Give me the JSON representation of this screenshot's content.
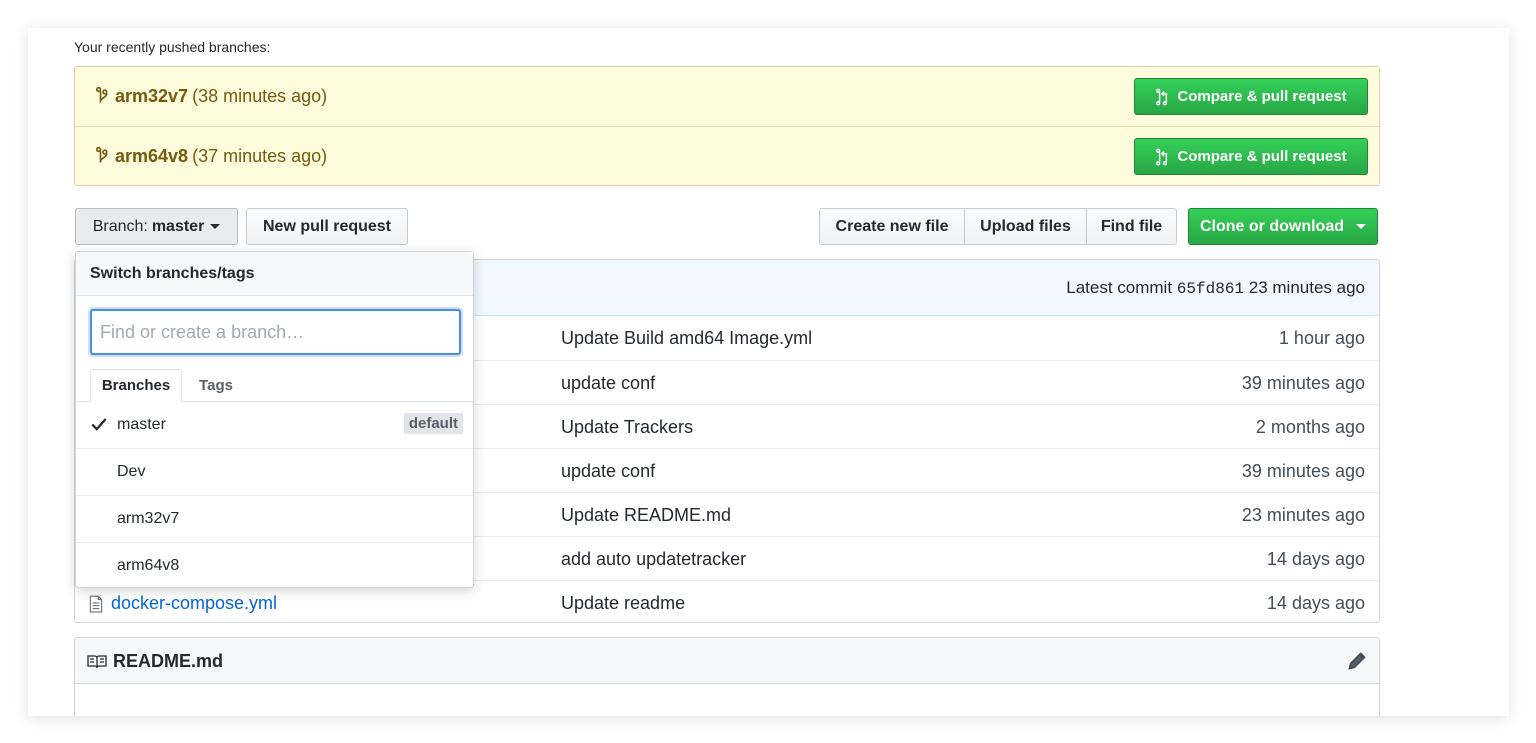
{
  "recent": {
    "label": "Your recently pushed branches:",
    "branches": [
      {
        "name": "arm32v7",
        "age": "(38 minutes ago)",
        "button": "Compare & pull request"
      },
      {
        "name": "arm64v8",
        "age": "(37 minutes ago)",
        "button": "Compare & pull request"
      }
    ]
  },
  "toolbar": {
    "branch_prefix": "Branch:",
    "branch_name": "master",
    "new_pr": "New pull request",
    "create_file": "Create new file",
    "upload_files": "Upload files",
    "find_file": "Find file",
    "clone": "Clone or download"
  },
  "commit": {
    "prefix": "Latest commit",
    "sha": "65fd861",
    "age": "23 minutes ago"
  },
  "files": [
    {
      "name": "",
      "message": "Update Build amd64 Image.yml",
      "age": "1 hour ago"
    },
    {
      "name": "",
      "message": "update conf",
      "age": "39 minutes ago"
    },
    {
      "name": "",
      "message": "Update Trackers",
      "age": "2 months ago"
    },
    {
      "name": "",
      "message": "update conf",
      "age": "39 minutes ago"
    },
    {
      "name": "",
      "message": "Update README.md",
      "age": "23 minutes ago"
    },
    {
      "name": "",
      "message": "add auto updatetracker",
      "age": "14 days ago"
    },
    {
      "name": "docker-compose.yml",
      "message": "Update readme",
      "age": "14 days ago"
    }
  ],
  "readme": {
    "title": "README.md"
  },
  "dropdown": {
    "title": "Switch branches/tags",
    "filter_placeholder": "Find or create a branch…",
    "tabs": [
      "Branches",
      "Tags"
    ],
    "items": [
      {
        "name": "master",
        "badge": "default"
      },
      {
        "name": "Dev"
      },
      {
        "name": "arm32v7"
      },
      {
        "name": "arm64v8"
      }
    ]
  },
  "colors": {
    "accent_green": "#28a745",
    "link_blue": "#0366d6",
    "recent_bg": "#fffbdd"
  },
  "icons": [
    "git-branch-icon",
    "pull-request-icon",
    "file-icon",
    "book-icon",
    "pencil-icon",
    "check-icon",
    "caret-down-icon"
  ]
}
